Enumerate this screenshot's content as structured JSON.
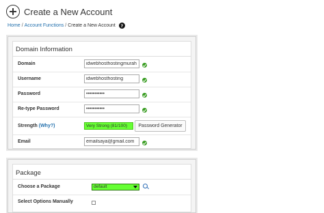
{
  "header": {
    "title": "Create a New Account"
  },
  "breadcrumb": {
    "home": "Home",
    "section": "Account Functions",
    "current": "Create a New Account",
    "sep": "/"
  },
  "domain_info": {
    "title": "Domain Information",
    "domain": {
      "label": "Domain",
      "value": "idwebhosthostingmurah"
    },
    "username": {
      "label": "Username",
      "value": "idwebhosthosting"
    },
    "password": {
      "label": "Password",
      "value": "•••••••••••"
    },
    "retype": {
      "label": "Re-type Password",
      "value": "•••••••••••"
    },
    "strength": {
      "label": "Strength",
      "why": "(Why?)",
      "value": "Very Strong (81/100)",
      "score": 81,
      "color": "#66ff33"
    },
    "password_generator": "Password Generator",
    "email": {
      "label": "Email",
      "value": "emailsaya@gmail.com"
    }
  },
  "package": {
    "title": "Package",
    "choose": {
      "label": "Choose a Package",
      "value": "default"
    },
    "select_options": {
      "label": "Select Options Manually",
      "checked": false
    }
  },
  "colors": {
    "accent": "#1e6dab",
    "ok": "#3a9d23",
    "strength": "#66ff33"
  }
}
